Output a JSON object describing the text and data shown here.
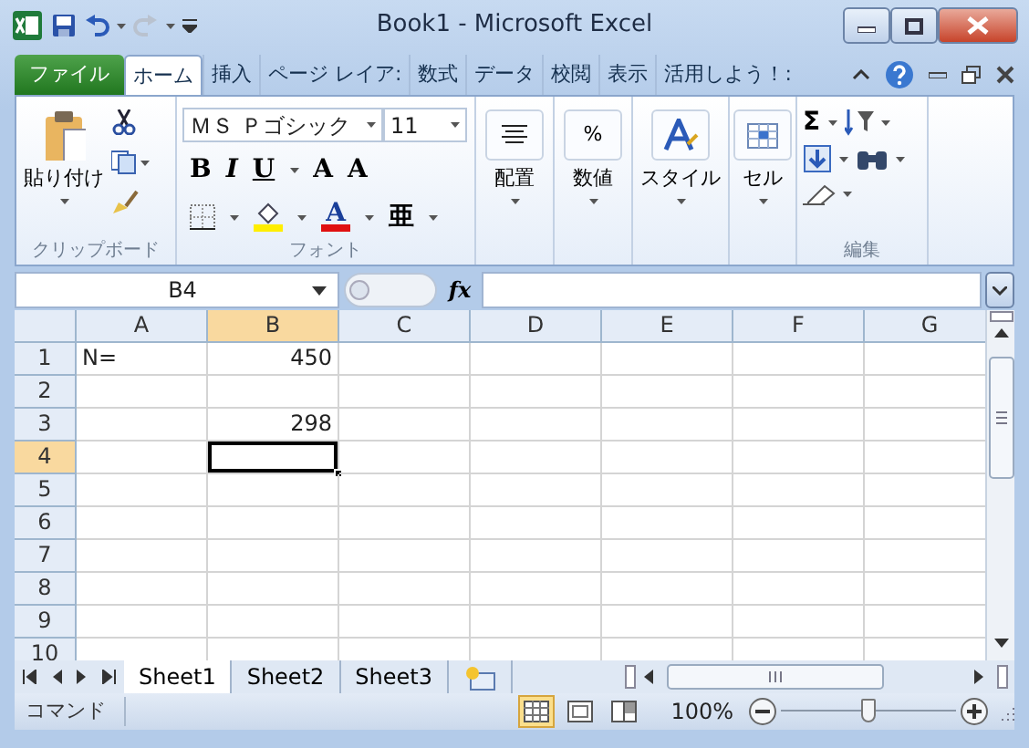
{
  "window": {
    "title": "Book1  -  Microsoft Excel"
  },
  "ribbon_tabs": [
    {
      "label": "ファイル",
      "kind": "file",
      "selected": false
    },
    {
      "label": "ホーム",
      "kind": "tab",
      "selected": true
    },
    {
      "label": "挿入",
      "kind": "tab",
      "selected": false
    },
    {
      "label": "ページ レイア:",
      "kind": "tab",
      "selected": false
    },
    {
      "label": "数式",
      "kind": "tab",
      "selected": false
    },
    {
      "label": "データ",
      "kind": "tab",
      "selected": false
    },
    {
      "label": "校閲",
      "kind": "tab",
      "selected": false
    },
    {
      "label": "表示",
      "kind": "tab",
      "selected": false
    },
    {
      "label": "活用しよう！:",
      "kind": "tab",
      "selected": false
    }
  ],
  "ribbon": {
    "clipboard": {
      "paste": "貼り付け",
      "label": "クリップボード"
    },
    "font": {
      "name": "ＭＳ Ｐゴシック",
      "size": "11",
      "bold": "B",
      "italic": "I",
      "underline": "U",
      "grow": "A",
      "shrink": "A",
      "font_color": "A",
      "phonetic": "亜",
      "label": "フォント"
    },
    "big_buttons": [
      {
        "label": "配置",
        "kind": "align"
      },
      {
        "label": "数値",
        "kind": "number",
        "glyph": "%"
      },
      {
        "label": "スタイル",
        "kind": "style"
      },
      {
        "label": "セル",
        "kind": "cells"
      }
    ],
    "editing": {
      "sum": "Σ",
      "label": "編集"
    }
  },
  "formula_bar": {
    "name_box": "B4",
    "function_label": "fx"
  },
  "sheet": {
    "columns": [
      {
        "label": "A",
        "selected": false
      },
      {
        "label": "B",
        "selected": true
      },
      {
        "label": "C",
        "selected": false
      },
      {
        "label": "D",
        "selected": false
      },
      {
        "label": "E",
        "selected": false
      },
      {
        "label": "F",
        "selected": false
      },
      {
        "label": "G",
        "selected": false
      }
    ],
    "rows": [
      {
        "label": "1",
        "selected": false,
        "cells": {
          "A": {
            "text": "N=",
            "kind": "text"
          },
          "B": {
            "text": "450",
            "kind": "number"
          }
        }
      },
      {
        "label": "2",
        "selected": false,
        "cells": {}
      },
      {
        "label": "3",
        "selected": false,
        "cells": {
          "B": {
            "text": "298",
            "kind": "number"
          }
        }
      },
      {
        "label": "4",
        "selected": true,
        "cells": {
          "B": {
            "active": true
          }
        }
      },
      {
        "label": "5",
        "selected": false,
        "cells": {}
      },
      {
        "label": "6",
        "selected": false,
        "cells": {}
      },
      {
        "label": "7",
        "selected": false,
        "cells": {}
      },
      {
        "label": "8",
        "selected": false,
        "cells": {}
      },
      {
        "label": "9",
        "selected": false,
        "cells": {}
      },
      {
        "label": "10",
        "selected": false,
        "cells": {}
      }
    ]
  },
  "sheet_tabs": [
    {
      "label": "Sheet1",
      "selected": true
    },
    {
      "label": "Sheet2",
      "selected": false
    },
    {
      "label": "Sheet3",
      "selected": false
    }
  ],
  "status_bar": {
    "mode": "コマンド",
    "views": [
      {
        "kind": "normal",
        "selected": true
      },
      {
        "kind": "page_layout",
        "selected": false
      },
      {
        "kind": "page_break",
        "selected": false
      }
    ],
    "zoom": "100%",
    "zoom_slider": {
      "level": 0.5
    }
  }
}
